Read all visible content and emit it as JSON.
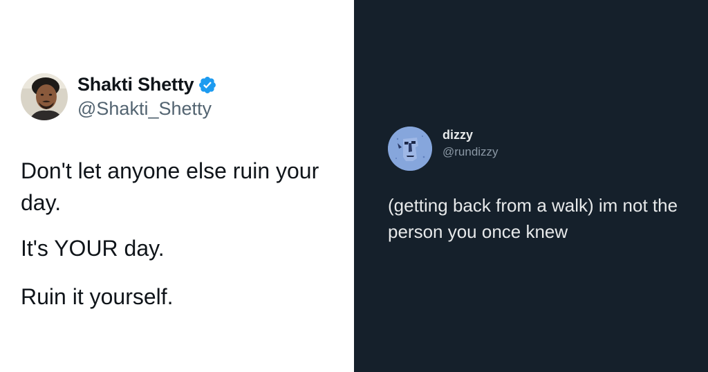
{
  "left_tweet": {
    "display_name": "Shakti Shetty",
    "handle": "@Shakti_Shetty",
    "verified_icon": "verified-badge",
    "lines": [
      "Don't let anyone else ruin your day.",
      "It's YOUR day.",
      "Ruin it yourself."
    ],
    "colors": {
      "background": "#ffffff",
      "text": "#0f1419",
      "handle": "#536471",
      "verified": "#1d9bf0"
    }
  },
  "right_tweet": {
    "display_name": "dizzy",
    "handle": "@rundizzy",
    "text": "(getting back from a walk) im not the person you once knew",
    "colors": {
      "background": "#15202b",
      "text": "#e7e9ea",
      "handle": "#8b98a5"
    }
  }
}
